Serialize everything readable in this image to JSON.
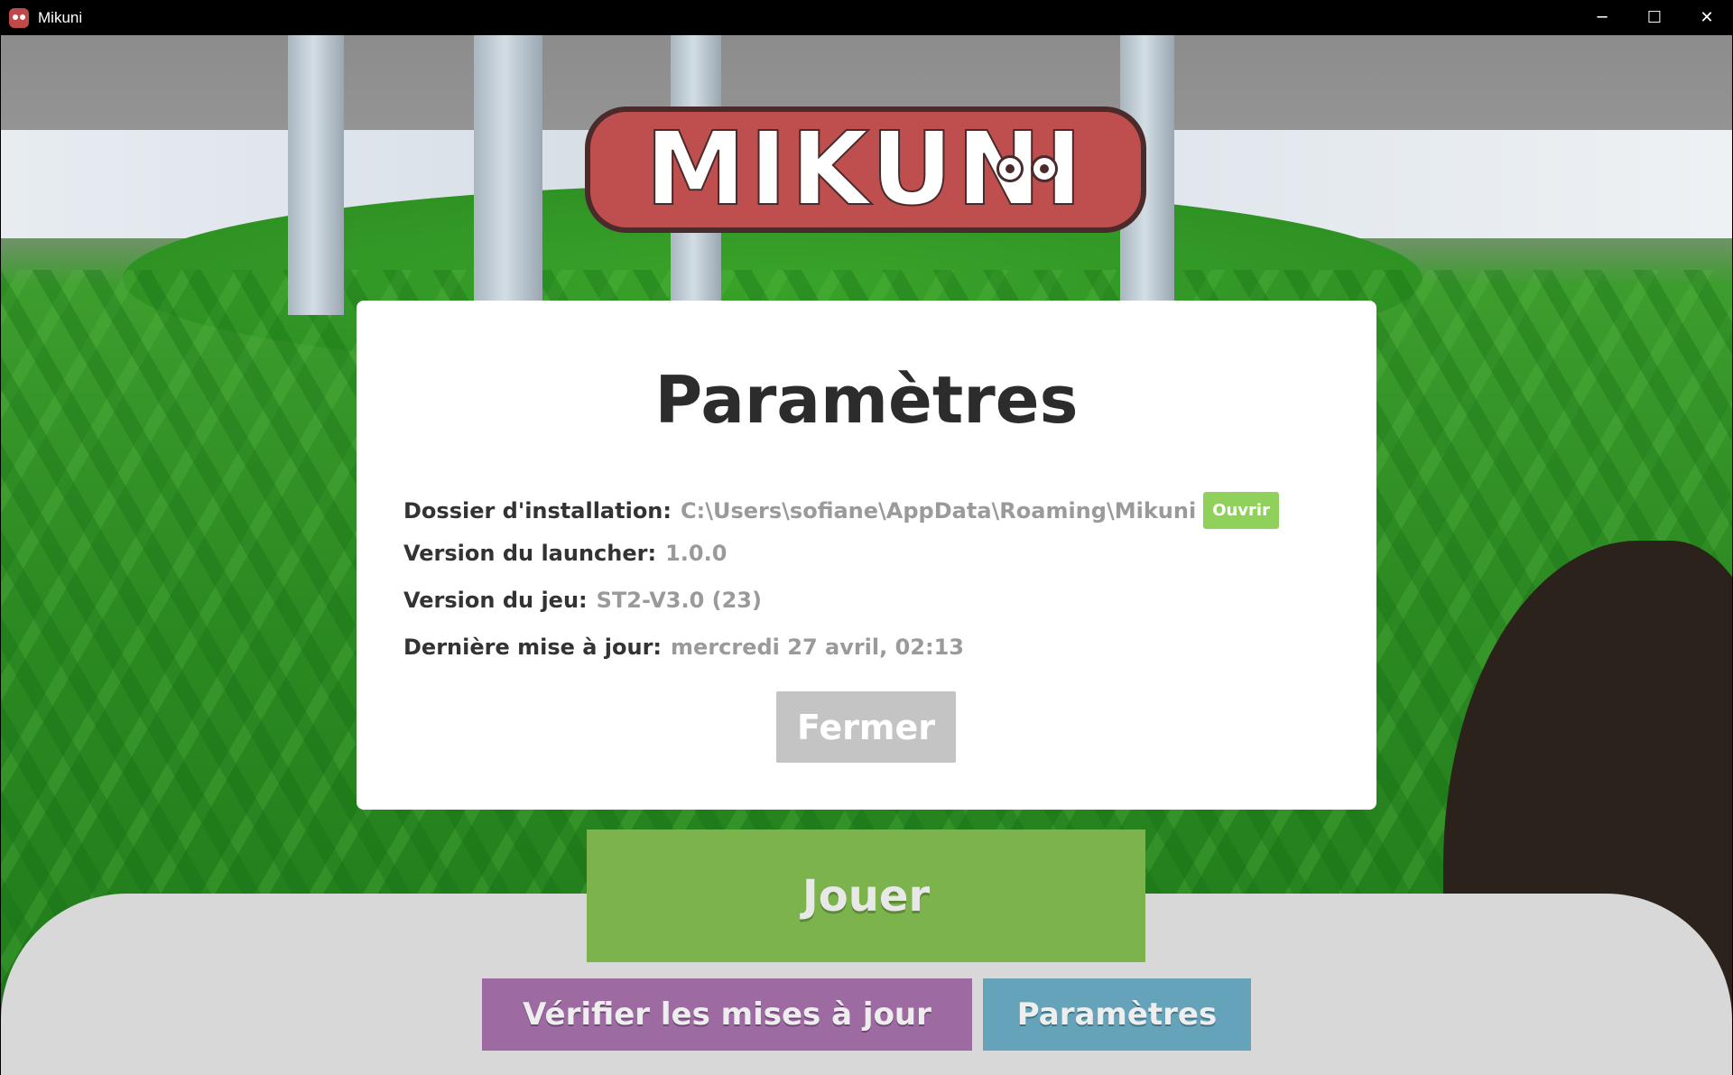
{
  "window": {
    "title": "Mikuni",
    "minimize_glyph": "─",
    "maximize_glyph": "☐",
    "close_glyph": "✕"
  },
  "logo": {
    "text": "MIKUNI"
  },
  "settings_modal": {
    "title": "Paramètres",
    "install_folder": {
      "label": "Dossier d'installation:",
      "value": "C:\\Users\\sofiane\\AppData\\Roaming\\Mikuni",
      "open_label": "Ouvrir"
    },
    "launcher_version": {
      "label": "Version du launcher:",
      "value": "1.0.0"
    },
    "game_version": {
      "label": "Version du jeu:",
      "value": "ST2-V3.0 (23)"
    },
    "last_update": {
      "label": "Dernière mise à jour:",
      "value": "mercredi 27 avril, 02:13"
    },
    "close_label": "Fermer"
  },
  "main_actions": {
    "play_label": "Jouer",
    "verify_label": "Vérifier les mises à jour",
    "settings_label": "Paramètres"
  },
  "colors": {
    "play": "#7cb34c",
    "verify": "#9d6aa2",
    "settings": "#64a3ba",
    "open": "#8fd15a",
    "close": "#c4c4c4",
    "logo": "#bf4f4f"
  }
}
